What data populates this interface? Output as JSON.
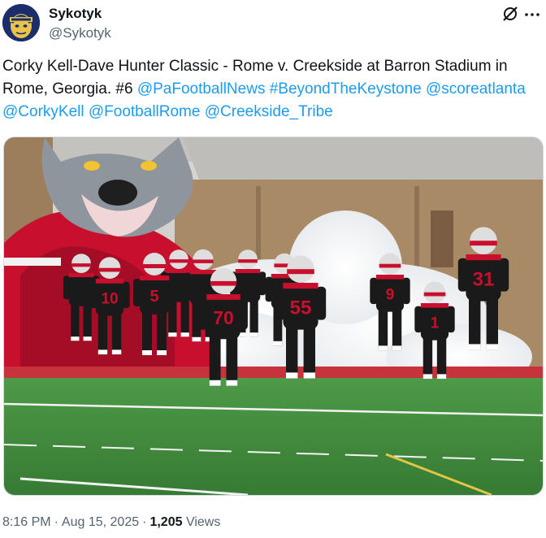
{
  "tweet": {
    "display_name": "Sykotyk",
    "handle": "@Sykotyk",
    "text_parts": [
      {
        "type": "text",
        "value": "Corky Kell-Dave Hunter Classic - Rome v. Creekside at Barron Stadium in Rome, Georgia. #6 "
      },
      {
        "type": "link",
        "value": "@PaFootballNews"
      },
      {
        "type": "text",
        "value": " "
      },
      {
        "type": "link",
        "value": "#BeyondTheKeystone"
      },
      {
        "type": "text",
        "value": " "
      },
      {
        "type": "link",
        "value": "@scoreatlanta"
      },
      {
        "type": "text",
        "value": " "
      },
      {
        "type": "link",
        "value": "@CorkyKell"
      },
      {
        "type": "text",
        "value": " "
      },
      {
        "type": "link",
        "value": "@FootballRome"
      },
      {
        "type": "text",
        "value": " "
      },
      {
        "type": "link",
        "value": "@Creekside_Tribe"
      }
    ],
    "time": "8:16 PM",
    "date": "Aug 15, 2025",
    "views_count": "1,205",
    "views_label": "Views"
  },
  "icons": {
    "grok": "grok-icon",
    "more": "more-icon"
  },
  "photo": {
    "jersey_numbers": [
      "5",
      "70",
      "55",
      "1",
      "9",
      "31",
      "10"
    ],
    "colors": {
      "jersey": "#1a1a1a",
      "trim": "#c8102e",
      "turf": "#3f8a3c",
      "track": "#c8323a",
      "smoke": "#f3f3f5",
      "wall": "#a98a66",
      "mascot": "#8f959c"
    }
  },
  "colors": {
    "link": "#1d9bf0",
    "secondary_text": "#536471",
    "primary_text": "#0f1419"
  }
}
